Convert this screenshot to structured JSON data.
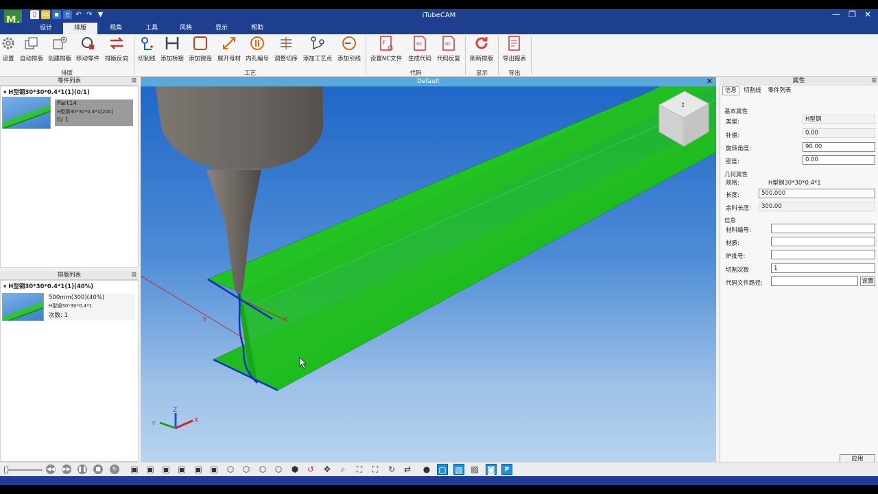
{
  "app": {
    "title": "iTubeCAM",
    "logo_text": "M.",
    "quick_access": [
      "new-icon",
      "open-icon",
      "save-icon",
      "save-as-icon",
      "undo-icon",
      "redo-icon",
      "shirt-icon"
    ],
    "window_controls": [
      "minimize-icon",
      "restore-icon",
      "close-icon"
    ]
  },
  "tabs": [
    {
      "label": "设计"
    },
    {
      "label": "排版",
      "active": true
    },
    {
      "label": "视角"
    },
    {
      "label": "工具"
    },
    {
      "label": "风格"
    },
    {
      "label": "显示"
    },
    {
      "label": "帮助"
    }
  ],
  "ribbon": {
    "groups": [
      {
        "label": "排版",
        "buttons": [
          "设置",
          "自动排版",
          "创建排版",
          "移动零件",
          "排版反向"
        ]
      },
      {
        "label": "工艺",
        "buttons": [
          "切割线",
          "添加桥接",
          "添加微连",
          "展开母材",
          "内孔编号",
          "调整切序",
          "添加工艺点",
          "添加引线"
        ]
      },
      {
        "label": "代码",
        "buttons": [
          "设置NC文件",
          "生成代码",
          "代码反复"
        ]
      },
      {
        "label": "显示",
        "buttons": [
          "刷新排版"
        ]
      },
      {
        "label": "导出",
        "buttons": [
          "导出报表"
        ]
      }
    ]
  },
  "parts_panel": {
    "title": "零件列表",
    "tree_header": "H型钢30*30*0.4*1(1)(0/1)",
    "item": {
      "name": "Part14",
      "spec": "H型钢30*30*0.4*1[200]",
      "count": "0/ 1"
    }
  },
  "nest_panel": {
    "title": "排版列表",
    "tree_header": "H型钢30*30*0.4*1(1)(40%)",
    "item": {
      "line1": "500mm(300)(40%)",
      "line2": "H型钢30*30*0.4*1",
      "line3": "次数:  1"
    }
  },
  "viewport": {
    "title": "Default",
    "axes": {
      "x": "X",
      "y": "Y",
      "z": "Z"
    },
    "colors": {
      "part": "#22c322",
      "edge": "#1030c0",
      "tool": "#6b6561"
    }
  },
  "properties": {
    "title": "属性",
    "tabs": [
      "信息",
      "切割线",
      "零件列表"
    ],
    "basic": {
      "title": "基本属性",
      "type_label": "类型:",
      "type_value": "H型钢",
      "comp_label": "补偿:",
      "comp_value": "0.00",
      "rot_label": "旋转角度:",
      "rot_value": "90.00",
      "density_label": "密度:",
      "density_value": "0.00"
    },
    "geometry": {
      "title": "几何属性",
      "spec_label": "规格:",
      "spec_value": "H型钢30*30*0.4*1",
      "length_label": "长度:",
      "length_value": "500.000",
      "remain_label": "余料长度:",
      "remain_value": "300.00"
    },
    "info": {
      "title": "信息",
      "mat_no_label": "材料编号:",
      "mat_no_value": "",
      "material_label": "材质:",
      "material_value": "",
      "heat_label": "炉批号:",
      "heat_value": "",
      "cut_count_label": "切割次数",
      "cut_count_value": "1",
      "code_path_label": "代码文件路径:",
      "code_path_value": "",
      "set_button": "设置"
    },
    "apply_button": "应用"
  },
  "bottom_toolbar": {
    "playback": [
      "rewind-icon",
      "forward-icon",
      "pause-icon",
      "stop-icon",
      "replay-icon"
    ],
    "views": [
      "view-front-icon",
      "view-back-icon",
      "view-left-icon",
      "view-right-icon",
      "view-top-icon",
      "view-bottom-icon",
      "iso-1-icon",
      "iso-2-icon",
      "iso-3-icon",
      "iso-4-icon",
      "rotate-x-icon",
      "pan-icon",
      "zoom-icon",
      "zoom-window-icon",
      "zoom-fit-icon",
      "rotate-icon",
      "swap-icon",
      "shade-icon",
      "wire-1-icon",
      "wire-2-icon",
      "wire-3-icon",
      "display-mode-icon",
      "p-mode-icon"
    ]
  }
}
